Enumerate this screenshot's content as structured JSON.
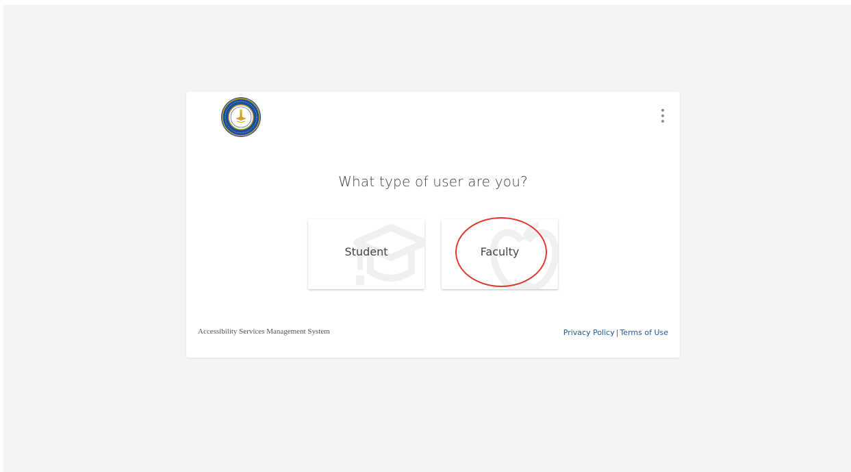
{
  "page": {
    "question": "What type of user are you?",
    "choices": [
      {
        "label": "Student",
        "icon": "graduation-cap-icon"
      },
      {
        "label": "Faculty",
        "icon": "apple-icon"
      }
    ],
    "footer": {
      "system_name": "Accessibility Services Management System",
      "privacy_label": "Privacy Policy",
      "separator": "|",
      "terms_label": "Terms of Use"
    },
    "menu_icon": "more-vertical-icon",
    "logo_icon": "college-seal-icon"
  },
  "colors": {
    "background": "#f4f4f4",
    "card": "#ffffff",
    "link": "#1f5c9e",
    "seal_blue": "#1c4f9a",
    "seal_gold": "#c9a227",
    "annotation_red": "#e03a2a"
  }
}
